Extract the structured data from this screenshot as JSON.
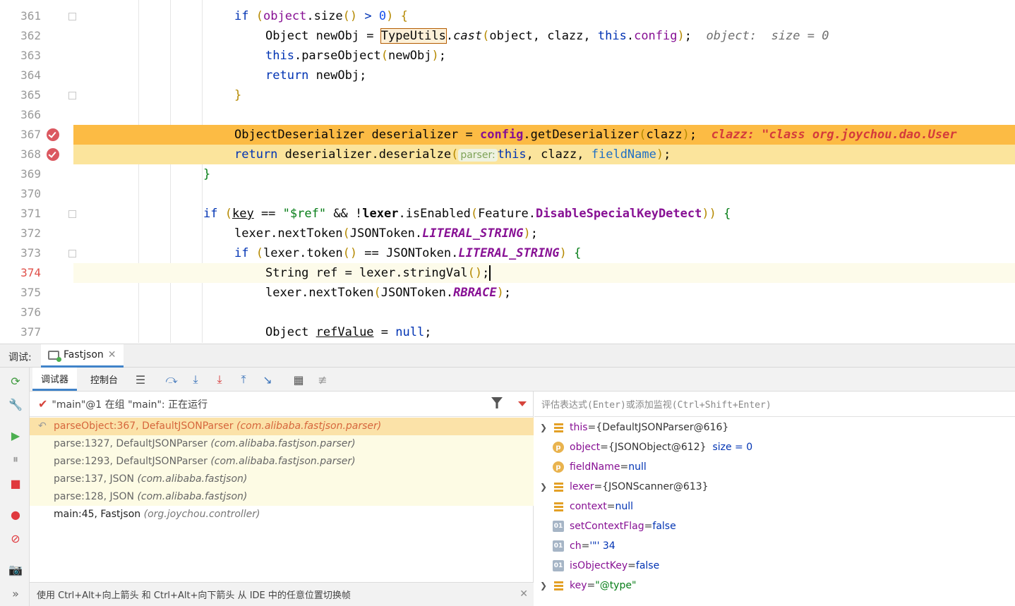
{
  "editor": {
    "lines": [
      {
        "num": "361"
      },
      {
        "num": "362"
      },
      {
        "num": "363"
      },
      {
        "num": "364"
      },
      {
        "num": "365"
      },
      {
        "num": "366"
      },
      {
        "num": "367"
      },
      {
        "num": "368"
      },
      {
        "num": "369"
      },
      {
        "num": "370"
      },
      {
        "num": "371"
      },
      {
        "num": "372"
      },
      {
        "num": "373"
      },
      {
        "num": "374"
      },
      {
        "num": "375"
      },
      {
        "num": "376"
      },
      {
        "num": "377"
      }
    ],
    "inline": {
      "object_debug": "object:  size = 0",
      "clazz_debug": "clazz: \"class org.joychou.dao.User",
      "param_hint": "parser:"
    }
  },
  "debug_tabbar": {
    "label": "调试:",
    "config_name": "Fastjson"
  },
  "toolbar": {
    "tab_debugger": "调试器",
    "tab_console": "控制台"
  },
  "thread": {
    "text": "\"main\"@1 在组 \"main\": 正在运行"
  },
  "frames": [
    {
      "method": "parseObject:367, DefaultJSONParser",
      "pkg": "(com.alibaba.fastjson.parser)"
    },
    {
      "method": "parse:1327, DefaultJSONParser",
      "pkg": "(com.alibaba.fastjson.parser)"
    },
    {
      "method": "parse:1293, DefaultJSONParser",
      "pkg": "(com.alibaba.fastjson.parser)"
    },
    {
      "method": "parse:137, JSON",
      "pkg": "(com.alibaba.fastjson)"
    },
    {
      "method": "parse:128, JSON",
      "pkg": "(com.alibaba.fastjson)"
    },
    {
      "method": "main:45, Fastjson",
      "pkg": "(org.joychou.controller)"
    }
  ],
  "hint_bar": "使用 Ctrl+Alt+向上箭头 和 Ctrl+Alt+向下箭头 从 IDE 中的任意位置切换帧",
  "eval": {
    "placeholder": "评估表达式(Enter)或添加监视(Ctrl+Shift+Enter)"
  },
  "variables": [
    {
      "name": "this",
      "eq": " = ",
      "val": "{DefaultJSONParser@616}",
      "extra": ""
    },
    {
      "name": "object",
      "eq": " = ",
      "val": "{JSONObject@612}",
      "extra": "size = 0"
    },
    {
      "name": "fieldName",
      "eq": " = ",
      "val": "null",
      "extra": ""
    },
    {
      "name": "lexer",
      "eq": " = ",
      "val": "{JSONScanner@613}",
      "extra": ""
    },
    {
      "name": "context",
      "eq": " = ",
      "val": "null",
      "extra": ""
    },
    {
      "name": "setContextFlag",
      "eq": " = ",
      "val": "false",
      "extra": ""
    },
    {
      "name": "ch",
      "eq": " = ",
      "val": "'\"' 34",
      "extra": ""
    },
    {
      "name": "isObjectKey",
      "eq": " = ",
      "val": "false",
      "extra": ""
    },
    {
      "name": "key",
      "eq": " = ",
      "val": "\"@type\"",
      "extra": ""
    }
  ],
  "colors": {
    "accent": "#4083c9",
    "exec_line": "#fcbb44",
    "breakpoint_line": "#fbe49c",
    "breakpoint": "#db5860"
  }
}
